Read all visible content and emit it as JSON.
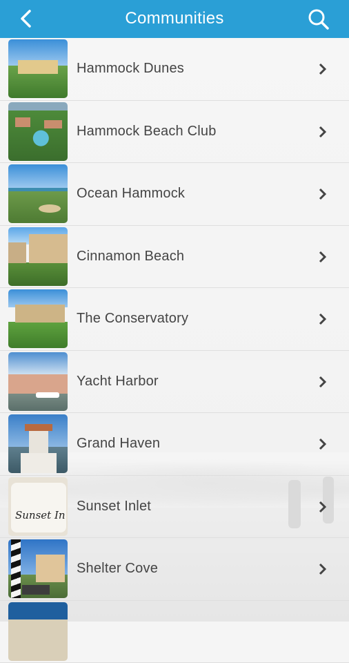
{
  "header": {
    "title": "Communities",
    "back_icon": "chevron-left-icon",
    "search_icon": "search-icon",
    "color": "#2a9fd6"
  },
  "communities": [
    {
      "label": "Hammock Dunes"
    },
    {
      "label": "Hammock Beach Club"
    },
    {
      "label": "Ocean Hammock"
    },
    {
      "label": "Cinnamon Beach"
    },
    {
      "label": "The Conservatory"
    },
    {
      "label": "Yacht Harbor"
    },
    {
      "label": "Grand Haven"
    },
    {
      "label": "Sunset Inlet"
    },
    {
      "label": "Shelter Cove"
    }
  ],
  "thumb_text": {
    "sunset_inlet": "Sunset Inlet"
  }
}
